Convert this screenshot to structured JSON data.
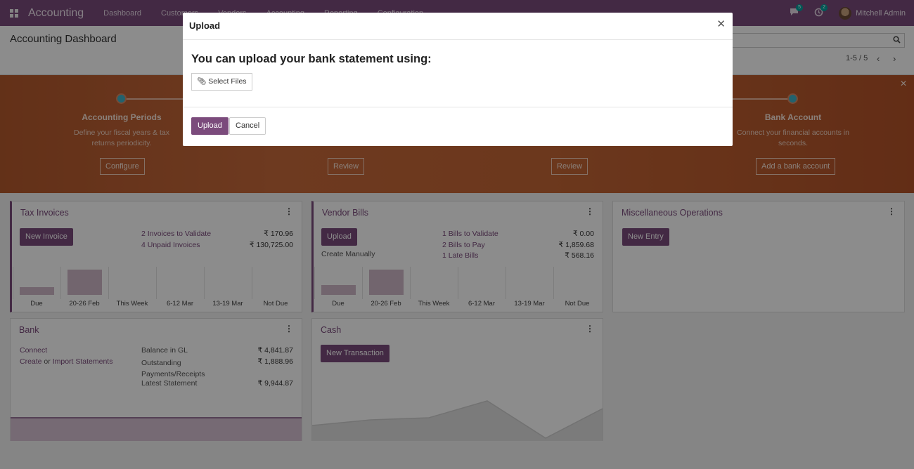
{
  "navbar": {
    "brand": "Accounting",
    "menu": [
      "Dashboard",
      "Customers",
      "Vendors",
      "Accounting",
      "Reporting",
      "Configuration"
    ],
    "messages_badge": "5",
    "activities_badge": "2",
    "user": "Mitchell Admin"
  },
  "control_panel": {
    "title": "Accounting Dashboard",
    "pager": "1-5 / 5"
  },
  "banner": {
    "steps": [
      {
        "title": "Accounting Periods",
        "desc": "Define your fiscal years & tax returns periodicity.",
        "button": "Configure"
      },
      {
        "title": "",
        "desc": "",
        "button": "Review"
      },
      {
        "title": "",
        "desc": "",
        "button": "Review"
      },
      {
        "title": "Bank Account",
        "desc": "Connect your financial accounts in seconds.",
        "button": "Add a bank account"
      }
    ]
  },
  "cards": {
    "tax_invoices": {
      "title": "Tax Invoices",
      "button": "New Invoice",
      "rows": [
        {
          "label": "2 Invoices to Validate",
          "amount": "₹ 170.96"
        },
        {
          "label": "4 Unpaid Invoices",
          "amount": "₹ 130,725.00"
        }
      ],
      "graph_labels": [
        "Due",
        "20-26 Feb",
        "This Week",
        "6-12 Mar",
        "13-19 Mar",
        "Not Due"
      ],
      "graph_values": [
        0.3,
        1.0,
        0,
        0,
        0,
        0
      ]
    },
    "vendor_bills": {
      "title": "Vendor Bills",
      "button": "Upload",
      "create_manually": "Create Manually",
      "rows": [
        {
          "label": "1 Bills to Validate",
          "amount": "₹ 0.00"
        },
        {
          "label": "2 Bills to Pay",
          "amount": "₹ 1,859.68"
        },
        {
          "label": "1 Late Bills",
          "amount": "₹ 568.16"
        }
      ],
      "graph_labels": [
        "Due",
        "20-26 Feb",
        "This Week",
        "6-12 Mar",
        "13-19 Mar",
        "Not Due"
      ],
      "graph_values": [
        0.4,
        1.0,
        0,
        0,
        0,
        0
      ]
    },
    "misc": {
      "title": "Miscellaneous Operations",
      "button": "New Entry"
    },
    "bank": {
      "title": "Bank",
      "connect": "Connect",
      "create": "Create",
      "or": " or ",
      "import": "Import Statements",
      "rows": [
        {
          "label": "Balance in GL",
          "amount": "₹ 4,841.87"
        },
        {
          "label": "Outstanding Payments/Receipts",
          "amount": "₹ 1,888.96"
        },
        {
          "label": "Latest Statement",
          "amount": "₹ 9,944.87"
        }
      ]
    },
    "cash": {
      "title": "Cash",
      "button": "New Transaction"
    }
  },
  "modal": {
    "title": "Upload",
    "heading": "You can upload your bank statement using:",
    "select_files": "Select Files",
    "upload": "Upload",
    "cancel": "Cancel"
  }
}
